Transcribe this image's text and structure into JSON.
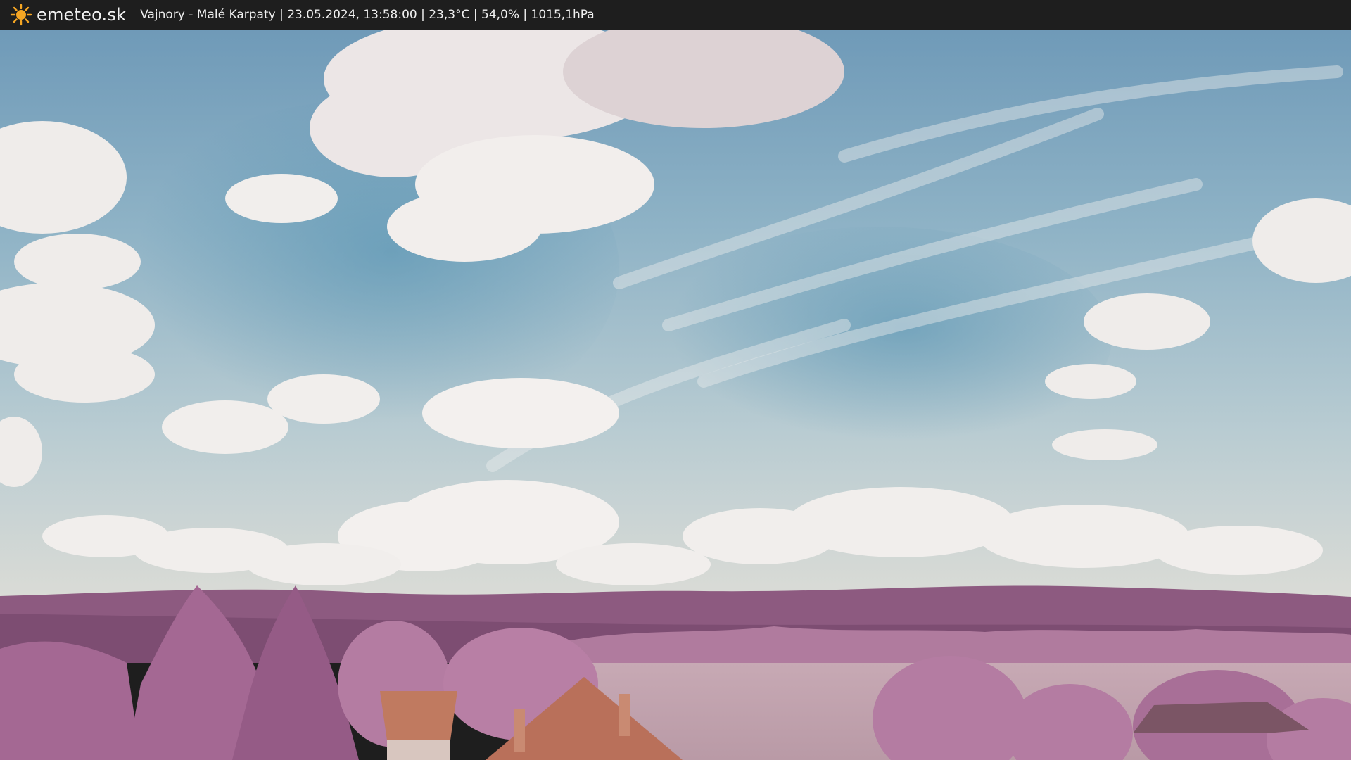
{
  "header": {
    "brand": "emeteo.sk",
    "caption": "Vajnory - Malé Karpaty | 23.05.2024, 13:58:00 | 23,3°C | 54,0% | 1015,1hPa",
    "logo_icon": "sun-icon",
    "logo_color": "#f5a623"
  },
  "webcam": {
    "scene": "infrared-landscape",
    "colors": {
      "sky_top": "#5f8fb0",
      "sky_mid": "#9fbccc",
      "sky_horizon": "#d9dcd6",
      "cloud": "#f2eeee",
      "hills": "#8a5a7e",
      "foliage": "#b0739d",
      "roof": "#b86c55"
    }
  }
}
